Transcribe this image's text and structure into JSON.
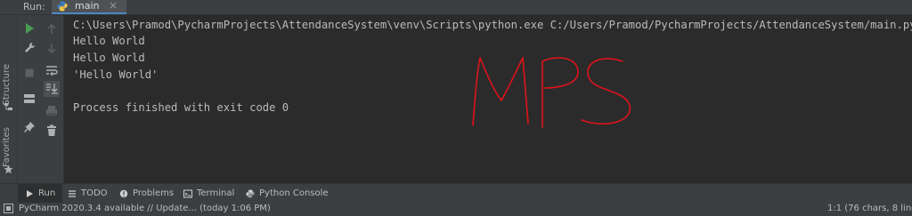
{
  "run_panel": {
    "label": "Run:",
    "tab": {
      "label": "main",
      "icon": "python-icon"
    }
  },
  "side_labels": {
    "structure": "Structure",
    "favorites": "Favorites"
  },
  "toolbar_left": [
    {
      "icon": "rerun-icon",
      "color": "#499c54"
    },
    {
      "icon": "wrench-icon"
    },
    {
      "icon": "stop-icon"
    },
    {
      "icon": "layout-icon"
    },
    {
      "icon": "pin-icon"
    }
  ],
  "toolbar_right": [
    {
      "icon": "scroll-up-icon"
    },
    {
      "icon": "scroll-down-icon"
    },
    {
      "icon": "soft-wrap-icon"
    },
    {
      "icon": "scroll-to-end-icon"
    },
    {
      "icon": "print-icon"
    },
    {
      "icon": "trash-icon"
    }
  ],
  "console": {
    "lines": [
      "C:\\Users\\Pramod\\PycharmProjects\\AttendanceSystem\\venv\\Scripts\\python.exe C:/Users/Pramod/PycharmProjects/AttendanceSystem/main.py",
      "Hello World",
      "Hello World",
      "'Hello World'",
      "",
      "Process finished with exit code 0"
    ],
    "watermark": "MPS",
    "watermark_color": "#e0131a"
  },
  "tool_tabs": [
    {
      "label": "Run",
      "icon": "play-icon",
      "active": true
    },
    {
      "label": "TODO",
      "icon": "list-icon"
    },
    {
      "label": "Problems",
      "icon": "problems-icon"
    },
    {
      "label": "Terminal",
      "icon": "terminal-icon"
    },
    {
      "label": "Python Console",
      "icon": "python-console-icon"
    }
  ],
  "status_bar": {
    "message": "PyCharm 2020.3.4 available // Update... (today 1:06 PM)",
    "position": "1:1 (76 chars, 8 line b"
  },
  "colors": {
    "accent": "#4a88c7",
    "background": "#2b2b2b",
    "panel": "#3c3f41"
  }
}
